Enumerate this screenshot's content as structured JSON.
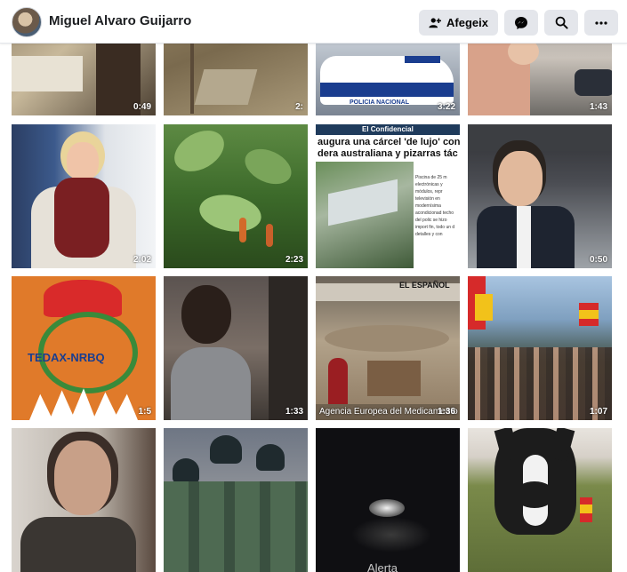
{
  "header": {
    "name": "Miguel Alvaro Guijarro",
    "add_label": "Afegeix"
  },
  "videos": [
    {
      "duration": "0:49"
    },
    {
      "duration": "2:"
    },
    {
      "duration": "3:22",
      "caption": "POLICIA NACIONAL"
    },
    {
      "duration": "1:43"
    },
    {
      "duration": "2:02"
    },
    {
      "duration": "2:23"
    },
    {
      "duration": "",
      "source": "El Confidencial",
      "headline_1": "augura una cárcel 'de lujo' con",
      "headline_2": "dera australiana y pizarras tác",
      "side_text": "Piscina de 25 m electrónicas y módulos, repr televisión en modernísima acondicionad techo del polic se hizo import fin, todo un d detalles y con"
    },
    {
      "duration": "0:50"
    },
    {
      "duration": "1:5",
      "badge_text": "TEDAX-NRBQ"
    },
    {
      "duration": "1:33"
    },
    {
      "duration": "1:36",
      "source": "EL ESPAÑOL",
      "caption": "Agencia Europea del Medicamento"
    },
    {
      "duration": "1:07"
    },
    {
      "duration": ""
    },
    {
      "duration": ""
    },
    {
      "duration": "",
      "caption": "Alerta"
    },
    {
      "duration": ""
    }
  ]
}
